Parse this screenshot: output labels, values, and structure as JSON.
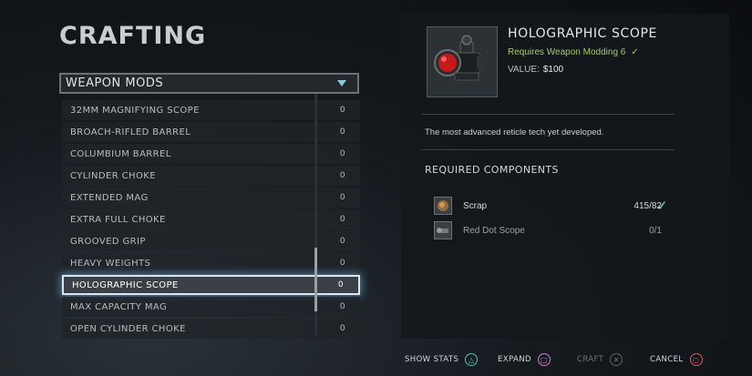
{
  "screen": {
    "title": "CRAFTING"
  },
  "category": {
    "label": "WEAPON MODS"
  },
  "items": [
    {
      "name": "32MM MAGNIFYING SCOPE",
      "qty": "0"
    },
    {
      "name": "BROACH-RIFLED BARREL",
      "qty": "0"
    },
    {
      "name": "COLUMBIUM BARREL",
      "qty": "0"
    },
    {
      "name": "CYLINDER CHOKE",
      "qty": "0"
    },
    {
      "name": "EXTENDED MAG",
      "qty": "0"
    },
    {
      "name": "EXTRA FULL CHOKE",
      "qty": "0"
    },
    {
      "name": "GROOVED GRIP",
      "qty": "0"
    },
    {
      "name": "HEAVY WEIGHTS",
      "qty": "0"
    },
    {
      "name": "HOLOGRAPHIC SCOPE",
      "qty": "0"
    },
    {
      "name": "MAX CAPACITY MAG",
      "qty": "0"
    },
    {
      "name": "OPEN CYLINDER CHOKE",
      "qty": "0"
    }
  ],
  "detail": {
    "name": "HOLOGRAPHIC SCOPE",
    "requires": "Requires Weapon Modding 6",
    "value_label": "VALUE:",
    "value": "$100",
    "description": "The most advanced reticle tech yet developed.",
    "components_title": "REQUIRED COMPONENTS",
    "components": [
      {
        "name": "Scrap",
        "count": "415/82",
        "icon": "scrap-icon"
      },
      {
        "name": "Red Dot Scope",
        "count": "0/1",
        "icon": "scope-icon"
      }
    ]
  },
  "footer": {
    "show_stats": "SHOW STATS",
    "expand": "EXPAND",
    "craft": "CRAFT",
    "cancel": "CANCEL"
  },
  "colors": {
    "accent_blue": "#8fc4dc",
    "requirement_green": "#a8c86a"
  }
}
